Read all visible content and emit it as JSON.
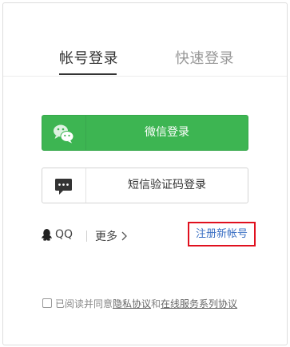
{
  "tabs": [
    {
      "label": "帐号登录",
      "active": true
    },
    {
      "label": "快速登录",
      "active": false
    }
  ],
  "wechat_button": {
    "label": "微信登录",
    "icon": "wechat-icon",
    "color": "#3db552"
  },
  "sms_button": {
    "label": "短信验证码登录",
    "icon": "sms-message-icon"
  },
  "other_login": {
    "qq_label": "QQ",
    "more_label": "更多"
  },
  "register_link": {
    "label": "注册新帐号",
    "color": "#3a6fc4",
    "highlight_color": "#e0101e"
  },
  "agreement": {
    "prefix": "已阅读并同意",
    "privacy_label": "隐私协议",
    "conjunction": "和",
    "service_label": "在线服务系列协议"
  }
}
